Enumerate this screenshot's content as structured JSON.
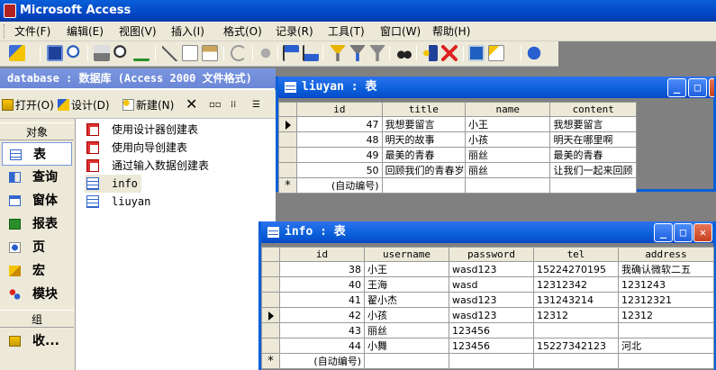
{
  "app": {
    "title": "Microsoft Access"
  },
  "menu": [
    "文件(F)",
    "编辑(E)",
    "视图(V)",
    "插入(I)",
    "格式(O)",
    "记录(R)",
    "工具(T)",
    "窗口(W)",
    "帮助(H)"
  ],
  "toolbar_icons": [
    "view-icon",
    "save-icon",
    "search-icon",
    "print-icon",
    "print-preview-icon",
    "spelling-icon",
    "cut-icon",
    "copy-icon",
    "paste-icon",
    "undo-icon",
    "hyperlink-icon",
    "sort-asc-icon",
    "sort-desc-icon",
    "filter-selection-icon",
    "filter-form-icon",
    "apply-filter-icon",
    "find-icon",
    "new-record-icon",
    "delete-record-icon",
    "database-window-icon",
    "new-object-icon",
    "help-icon"
  ],
  "db_window": {
    "title": "database : 数据库 (Access 2000 文件格式)",
    "toolbar": {
      "open": "打开(O)",
      "design": "设计(D)",
      "new": "新建(N)"
    },
    "objects_header": "对象",
    "objects": [
      "表",
      "查询",
      "窗体",
      "报表",
      "页",
      "宏",
      "模块"
    ],
    "groups_header": "组",
    "groups": [
      "收..."
    ],
    "list": [
      "使用设计器创建表",
      "使用向导创建表",
      "通过输入数据创建表",
      "info",
      "liuyan"
    ]
  },
  "liuyan_window": {
    "title": "liuyan : 表",
    "columns": [
      "id",
      "title",
      "name",
      "content"
    ],
    "rows": [
      [
        "47",
        "我想要留言",
        "小王",
        "我想要留言"
      ],
      [
        "48",
        "明天的故事",
        "小孩",
        "明天在哪里啊"
      ],
      [
        "49",
        "最美的青春",
        "丽丝",
        "最美的青春"
      ],
      [
        "50",
        "回顾我们的青春岁",
        "丽丝",
        "让我们一起来回顾"
      ]
    ],
    "new_row": "(自动编号)",
    "current_row": 0
  },
  "info_window": {
    "title": "info : 表",
    "columns": [
      "id",
      "username",
      "password",
      "tel",
      "address"
    ],
    "rows": [
      [
        "38",
        "小王",
        "wasd123",
        "15224270195",
        "我确认微软二五"
      ],
      [
        "40",
        "王海",
        "wasd",
        "12312342",
        "1231243"
      ],
      [
        "41",
        "翟小杰",
        "wasd123",
        "131243214",
        "12312321"
      ],
      [
        "42",
        "小孩",
        "wasd123",
        "12312",
        "12312"
      ],
      [
        "43",
        "丽丝",
        "123456",
        "",
        ""
      ],
      [
        "44",
        "小舞",
        "123456",
        "15227342123",
        "河北"
      ]
    ],
    "new_row": "(自动编号)",
    "current_row": 3
  }
}
